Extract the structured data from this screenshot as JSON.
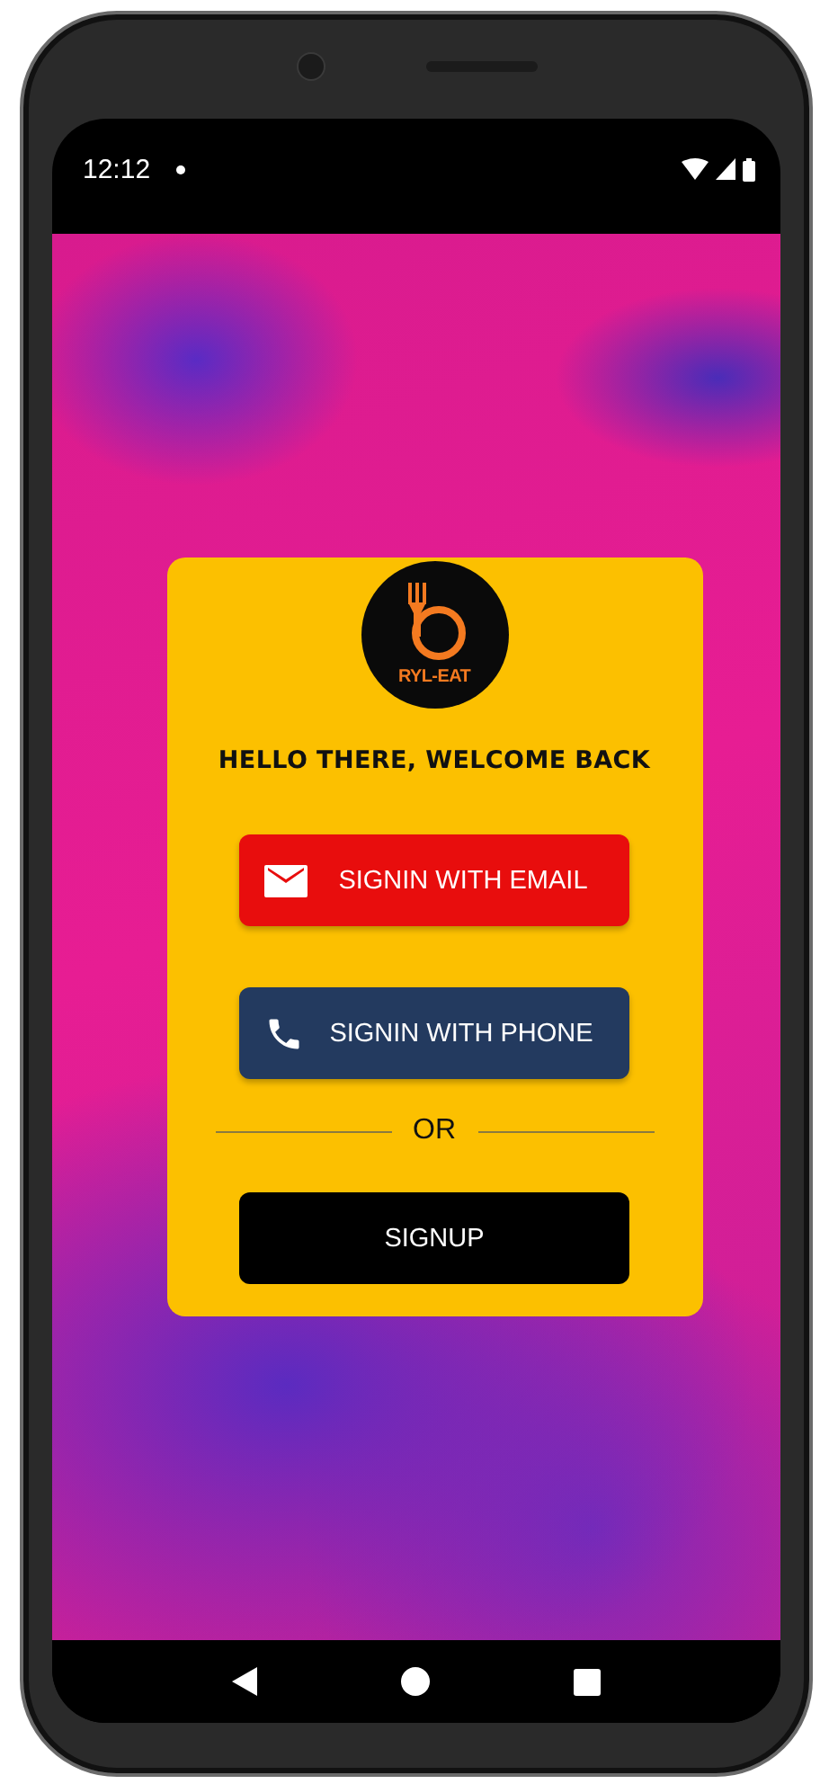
{
  "status_bar": {
    "time": "12:12"
  },
  "card": {
    "logo_text": "RYL-EAT",
    "heading": "HELLO THERE, WELCOME BACK",
    "buttons": [
      {
        "kind": "email",
        "label": "SIGNIN WITH EMAIL",
        "color": "#e80d0d"
      },
      {
        "kind": "phone",
        "label": "SIGNIN WITH PHONE",
        "color": "#233a5f"
      }
    ],
    "divider_text": "OR",
    "signup_button": "SIGNUP"
  }
}
